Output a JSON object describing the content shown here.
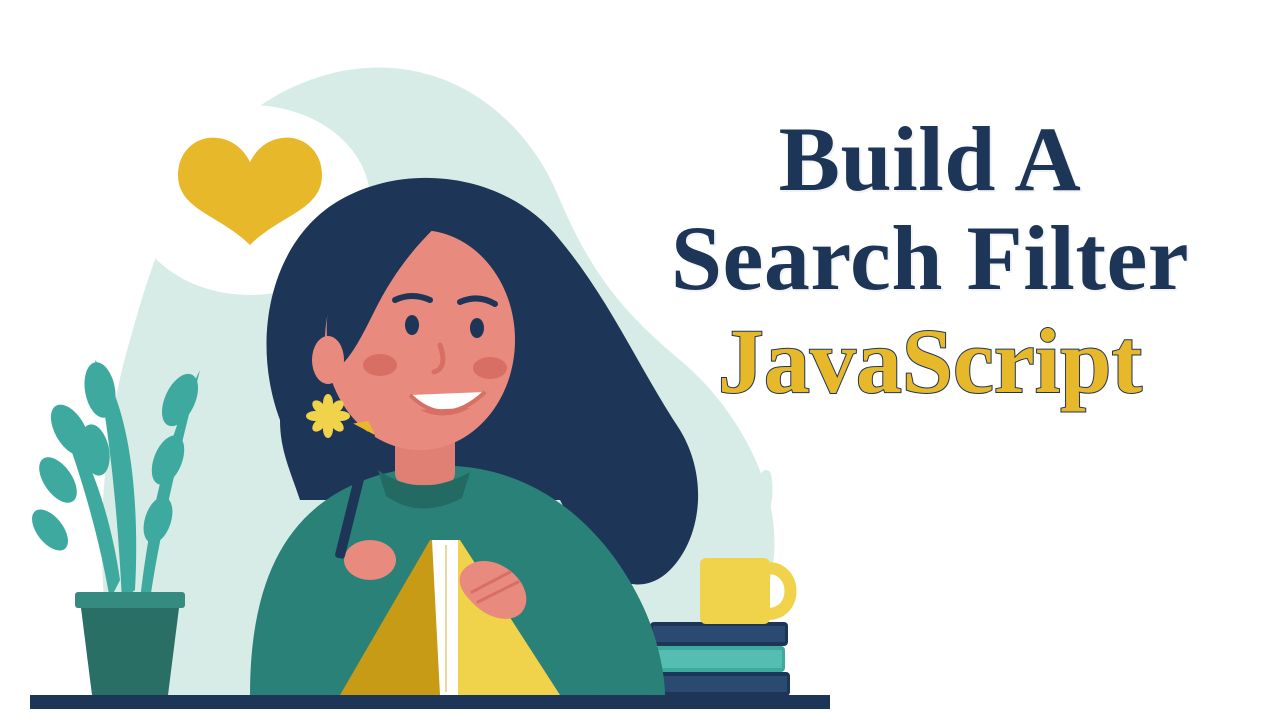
{
  "title": {
    "line1": "Build A",
    "line2": "Search Filter",
    "accent": "JavaScript"
  },
  "colors": {
    "navy": "#1d3557",
    "yellow": "#e6b82a",
    "teal": "#3ea99f",
    "teal_light": "#d5ece6",
    "skin": "#e98a7e",
    "skin_dark": "#d86f65",
    "sweater": "#2a8178",
    "white": "#ffffff",
    "book_dark": "#c79b15",
    "desk": "#1d3557",
    "book1": "#3ea99f",
    "book2": "#1d3557",
    "mug": "#f0d34a",
    "plant": "#3ea99f",
    "pot": "#2a6f66"
  },
  "illustration": {
    "description": "Flat-style illustration of a woman with long dark wavy hair, wearing a teal sweater, writing in an open yellow notebook at a desk. A thought bubble with a yellow heart floats above her to the left. A potted plant with teal leaves sits on the left, a stack of books and a yellow mug with steam on the right. Soft mint blob background.",
    "elements": [
      "background-blob",
      "thought-bubble",
      "heart-icon",
      "plant",
      "woman",
      "notebook",
      "pencil",
      "books-stack",
      "mug",
      "desk"
    ]
  }
}
